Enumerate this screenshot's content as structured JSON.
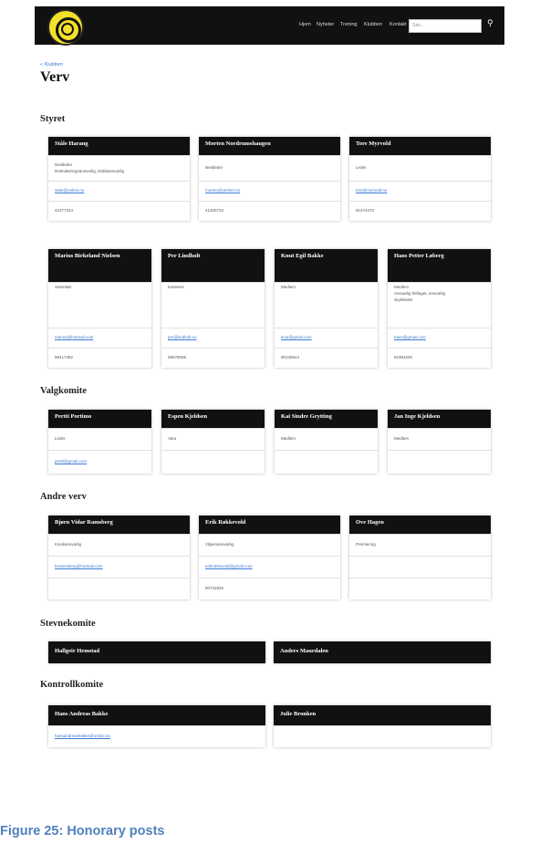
{
  "header": {
    "nav": [
      "Hjem",
      "Nyheter",
      "Trening",
      "Klubben",
      "Kontakt"
    ],
    "search_placeholder": "Søk..."
  },
  "breadcrumb": "« Klubben",
  "page_title": "Verv",
  "caption": "Figure 25: Honorary posts",
  "styret": {
    "title": "Styret",
    "c1": {
      "name": "Ståle Harang",
      "role": "Nestleder",
      "role2": "Rekrutteringsansvarlig, klubbansvarlig",
      "email": "stale@online.no",
      "phone": "41477344"
    },
    "c2": {
      "name": "Morten Nordrumshaugen",
      "role": "Nestleder",
      "email": "morten@vtelnet.no",
      "phone": "41320734"
    },
    "c3": {
      "name": "Tore Myrvold",
      "role": "Leder",
      "email": "tore@myrvold.no",
      "phone": "91474472"
    },
    "c4": {
      "name": "Marius Birkeland Nielsen",
      "role": "Sekretær",
      "email": "marius@hotmail.com",
      "phone": "98417462"
    },
    "c5": {
      "name": "Per Lindholt",
      "role": "Kasserer",
      "email": "per@lindholt.no",
      "phone": "99578006"
    },
    "c6": {
      "name": "Knut Egil Bakke",
      "role": "Medlem",
      "email": "knut@gmail.com",
      "phone": "90135544"
    },
    "c7": {
      "name": "Hans Petter Løberg",
      "role": "Medlem",
      "role2": "Ansvarlig feltlaget, ansvarlig",
      "role3": "skyteleder",
      "email": "hans@gmail.com",
      "phone": "92364200"
    }
  },
  "valgkomite": {
    "title": "Valgkomite",
    "c1": {
      "name": "Pertti Portimo",
      "role": "Leder",
      "email": "pertti@gmail.com"
    },
    "c2": {
      "name": "Espen Kjeldsen",
      "role": "Vara"
    },
    "c3": {
      "name": "Kai Sindre Grytting",
      "role": "Medlem"
    },
    "c4": {
      "name": "Jan Inge Kjeldsen",
      "role": "Medlem"
    }
  },
  "andre": {
    "title": "Andre verv",
    "c1": {
      "name": "Bjørn Vidar Ramsberg",
      "role": "Kioskansvarlig",
      "email": "bvramsberg@hotmail.com"
    },
    "c2": {
      "name": "Erik Røkkevold",
      "role": "Våpenansvarlig",
      "email": "erikrokkevold@gmail.com",
      "phone": "90732945"
    },
    "c3": {
      "name": "Ove Hagen",
      "role": "Premiering"
    }
  },
  "stevne": {
    "title": "Stevnekomite",
    "c1": {
      "name": "Hallgeir Hemstad"
    },
    "c2": {
      "name": "Anders Maurdalen"
    }
  },
  "kontroll": {
    "title": "Kontrollkomite",
    "c1": {
      "name": "Hans Andreas Bakke",
      "email": "hansandreasbakke@online.no"
    },
    "c2": {
      "name": "Julie Bronken"
    }
  }
}
